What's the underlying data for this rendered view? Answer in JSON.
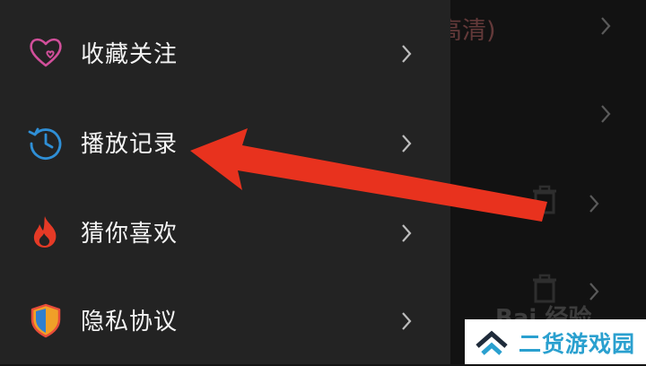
{
  "background": {
    "title_fragment": "高清)"
  },
  "menu": {
    "items": [
      {
        "label": "收藏关注",
        "icon": "heart-outline-icon"
      },
      {
        "label": "播放记录",
        "icon": "history-clock-icon"
      },
      {
        "label": "猜你喜欢",
        "icon": "flame-icon"
      },
      {
        "label": "隐私协议",
        "icon": "shield-icon"
      }
    ]
  },
  "watermark": {
    "text": "二货游戏园",
    "baidu": "Bai 经验"
  },
  "colors": {
    "drawer_bg": "#232323",
    "arrow": "#e8321e",
    "watermark_text": "#2aa0cf"
  }
}
